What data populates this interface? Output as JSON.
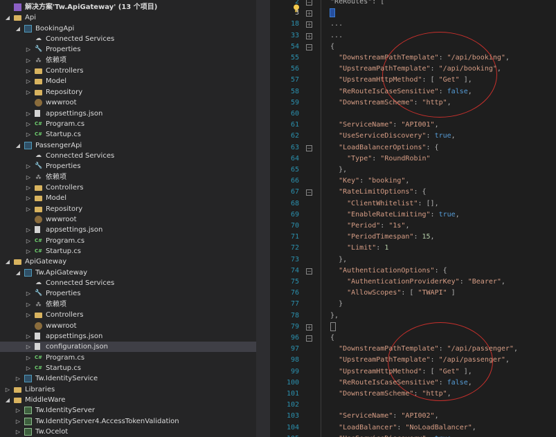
{
  "explorer": {
    "rows": [
      {
        "indent": 0,
        "arrow": "",
        "icon": "solution",
        "label": "解决方案'Tw.ApiGateway' (13 个项目)",
        "name": "solution-root"
      },
      {
        "indent": 0,
        "arrow": "open",
        "icon": "folder",
        "label": "Api",
        "name": "folder-api"
      },
      {
        "indent": 1,
        "arrow": "open",
        "icon": "project",
        "label": "BookingApi",
        "name": "project-bookingapi"
      },
      {
        "indent": 2,
        "arrow": "",
        "icon": "cloud",
        "label": "Connected Services",
        "name": "tree-item"
      },
      {
        "indent": 2,
        "arrow": "closed",
        "icon": "wrench",
        "label": "Properties",
        "name": "tree-item"
      },
      {
        "indent": 2,
        "arrow": "closed",
        "icon": "deps",
        "label": "依赖项",
        "name": "tree-item"
      },
      {
        "indent": 2,
        "arrow": "closed",
        "icon": "folder",
        "label": "Controllers",
        "name": "tree-item"
      },
      {
        "indent": 2,
        "arrow": "closed",
        "icon": "folder",
        "label": "Model",
        "name": "tree-item"
      },
      {
        "indent": 2,
        "arrow": "closed",
        "icon": "folder",
        "label": "Repository",
        "name": "tree-item"
      },
      {
        "indent": 2,
        "arrow": "",
        "icon": "web",
        "label": "wwwroot",
        "name": "tree-item"
      },
      {
        "indent": 2,
        "arrow": "closed",
        "icon": "json",
        "label": "appsettings.json",
        "name": "tree-item"
      },
      {
        "indent": 2,
        "arrow": "closed",
        "icon": "cs",
        "label": "Program.cs",
        "name": "tree-item"
      },
      {
        "indent": 2,
        "arrow": "closed",
        "icon": "cs",
        "label": "Startup.cs",
        "name": "tree-item"
      },
      {
        "indent": 1,
        "arrow": "open",
        "icon": "project",
        "label": "PassengerApi",
        "name": "project-passengerapi"
      },
      {
        "indent": 2,
        "arrow": "",
        "icon": "cloud",
        "label": "Connected Services",
        "name": "tree-item"
      },
      {
        "indent": 2,
        "arrow": "closed",
        "icon": "wrench",
        "label": "Properties",
        "name": "tree-item"
      },
      {
        "indent": 2,
        "arrow": "closed",
        "icon": "deps",
        "label": "依赖项",
        "name": "tree-item"
      },
      {
        "indent": 2,
        "arrow": "closed",
        "icon": "folder",
        "label": "Controllers",
        "name": "tree-item"
      },
      {
        "indent": 2,
        "arrow": "closed",
        "icon": "folder",
        "label": "Model",
        "name": "tree-item"
      },
      {
        "indent": 2,
        "arrow": "closed",
        "icon": "folder",
        "label": "Repository",
        "name": "tree-item"
      },
      {
        "indent": 2,
        "arrow": "",
        "icon": "web",
        "label": "wwwroot",
        "name": "tree-item"
      },
      {
        "indent": 2,
        "arrow": "closed",
        "icon": "json",
        "label": "appsettings.json",
        "name": "tree-item"
      },
      {
        "indent": 2,
        "arrow": "closed",
        "icon": "cs",
        "label": "Program.cs",
        "name": "tree-item"
      },
      {
        "indent": 2,
        "arrow": "closed",
        "icon": "cs",
        "label": "Startup.cs",
        "name": "tree-item"
      },
      {
        "indent": 0,
        "arrow": "open",
        "icon": "folder",
        "label": "ApiGateway",
        "name": "folder-apigateway"
      },
      {
        "indent": 1,
        "arrow": "open",
        "icon": "project",
        "label": "Tw.ApiGateway",
        "name": "project-tw-apigateway"
      },
      {
        "indent": 2,
        "arrow": "",
        "icon": "cloud",
        "label": "Connected Services",
        "name": "tree-item"
      },
      {
        "indent": 2,
        "arrow": "closed",
        "icon": "wrench",
        "label": "Properties",
        "name": "tree-item"
      },
      {
        "indent": 2,
        "arrow": "closed",
        "icon": "deps",
        "label": "依赖项",
        "name": "tree-item"
      },
      {
        "indent": 2,
        "arrow": "closed",
        "icon": "folder",
        "label": "Controllers",
        "name": "tree-item"
      },
      {
        "indent": 2,
        "arrow": "",
        "icon": "web",
        "label": "wwwroot",
        "name": "tree-item"
      },
      {
        "indent": 2,
        "arrow": "closed",
        "icon": "json",
        "label": "appsettings.json",
        "name": "tree-item"
      },
      {
        "indent": 2,
        "arrow": "closed",
        "icon": "json",
        "label": "configuration.json",
        "name": "tree-item-configuration-json",
        "selected": true
      },
      {
        "indent": 2,
        "arrow": "closed",
        "icon": "cs",
        "label": "Program.cs",
        "name": "tree-item"
      },
      {
        "indent": 2,
        "arrow": "closed",
        "icon": "cs",
        "label": "Startup.cs",
        "name": "tree-item"
      },
      {
        "indent": 1,
        "arrow": "closed",
        "icon": "project",
        "label": "Tw.IdentityService",
        "name": "project-tw-identityservice"
      },
      {
        "indent": 0,
        "arrow": "closed",
        "icon": "folder",
        "label": "Libraries",
        "name": "folder-libraries"
      },
      {
        "indent": 0,
        "arrow": "open",
        "icon": "folder",
        "label": "MiddleWare",
        "name": "folder-middleware"
      },
      {
        "indent": 1,
        "arrow": "closed",
        "icon": "cr",
        "label": "Tw.IdentityServer",
        "name": "project-tw-identityserver"
      },
      {
        "indent": 1,
        "arrow": "closed",
        "icon": "cr",
        "label": "Tw.IdentityServer4.AccessTokenValidation",
        "name": "project-tw-identityserver4"
      },
      {
        "indent": 1,
        "arrow": "closed",
        "icon": "cr",
        "label": "Tw.Ocelot",
        "name": "project-tw-ocelot"
      }
    ]
  },
  "editor": {
    "lines": [
      {
        "num": "2",
        "fold": "open",
        "code": [
          [
            "p",
            "  \"ReRoutes\": ["
          ]
        ]
      },
      {
        "num": "3",
        "fold": "closed",
        "current": true,
        "code": [
          [
            "p",
            "  "
          ],
          [
            "cur",
            " "
          ]
        ]
      },
      {
        "num": "18",
        "fold": "closed",
        "code": [
          [
            "p",
            "  ..."
          ]
        ]
      },
      {
        "num": "33",
        "fold": "closed",
        "code": [
          [
            "p",
            "  ..."
          ]
        ]
      },
      {
        "num": "54",
        "fold": "open",
        "code": [
          [
            "p",
            "  {"
          ]
        ]
      },
      {
        "num": "55",
        "fold": "",
        "code": [
          [
            "k",
            "    \"DownstreamPathTemplate\""
          ],
          [
            "p",
            ": "
          ],
          [
            "k",
            "\"/api/booking\""
          ],
          [
            "p",
            ","
          ]
        ]
      },
      {
        "num": "56",
        "fold": "",
        "code": [
          [
            "k",
            "    \"UpstreamPathTemplate\""
          ],
          [
            "p",
            ": "
          ],
          [
            "k",
            "\"/api/booking\""
          ],
          [
            "p",
            ","
          ]
        ]
      },
      {
        "num": "57",
        "fold": "",
        "code": [
          [
            "k",
            "    \"UpstreamHttpMethod\""
          ],
          [
            "p",
            ": [ "
          ],
          [
            "k",
            "\"Get\""
          ],
          [
            "p",
            " ],"
          ]
        ]
      },
      {
        "num": "58",
        "fold": "",
        "code": [
          [
            "k",
            "    \"ReRouteIsCaseSensitive\""
          ],
          [
            "p",
            ": "
          ],
          [
            "b",
            "false"
          ],
          [
            "p",
            ","
          ]
        ]
      },
      {
        "num": "59",
        "fold": "",
        "code": [
          [
            "k",
            "    \"DownstreamScheme\""
          ],
          [
            "p",
            ": "
          ],
          [
            "k",
            "\"http\""
          ],
          [
            "p",
            ","
          ]
        ]
      },
      {
        "num": "60",
        "fold": "",
        "code": [
          [
            "p",
            ""
          ]
        ]
      },
      {
        "num": "61",
        "fold": "",
        "code": [
          [
            "k",
            "    \"ServiceName\""
          ],
          [
            "p",
            ": "
          ],
          [
            "k",
            "\"API001\""
          ],
          [
            "p",
            ","
          ]
        ]
      },
      {
        "num": "62",
        "fold": "",
        "code": [
          [
            "k",
            "    \"UseServiceDiscovery\""
          ],
          [
            "p",
            ": "
          ],
          [
            "b",
            "true"
          ],
          [
            "p",
            ","
          ]
        ]
      },
      {
        "num": "63",
        "fold": "open",
        "code": [
          [
            "k",
            "    \"LoadBalancerOptions\""
          ],
          [
            "p",
            ": {"
          ]
        ]
      },
      {
        "num": "64",
        "fold": "",
        "code": [
          [
            "k",
            "      \"Type\""
          ],
          [
            "p",
            ": "
          ],
          [
            "k",
            "\"RoundRobin\""
          ]
        ]
      },
      {
        "num": "65",
        "fold": "",
        "code": [
          [
            "p",
            "    },"
          ]
        ]
      },
      {
        "num": "66",
        "fold": "",
        "code": [
          [
            "k",
            "    \"Key\""
          ],
          [
            "p",
            ": "
          ],
          [
            "k",
            "\"booking\""
          ],
          [
            "p",
            ","
          ]
        ]
      },
      {
        "num": "67",
        "fold": "open",
        "code": [
          [
            "k",
            "    \"RateLimitOptions\""
          ],
          [
            "p",
            ": {"
          ]
        ]
      },
      {
        "num": "68",
        "fold": "",
        "code": [
          [
            "k",
            "      \"ClientWhitelist\""
          ],
          [
            "p",
            ": [],"
          ]
        ]
      },
      {
        "num": "69",
        "fold": "",
        "code": [
          [
            "k",
            "      \"EnableRateLimiting\""
          ],
          [
            "p",
            ": "
          ],
          [
            "b",
            "true"
          ],
          [
            "p",
            ","
          ]
        ]
      },
      {
        "num": "70",
        "fold": "",
        "code": [
          [
            "k",
            "      \"Period\""
          ],
          [
            "p",
            ": "
          ],
          [
            "k",
            "\"1s\""
          ],
          [
            "p",
            ","
          ]
        ]
      },
      {
        "num": "71",
        "fold": "",
        "code": [
          [
            "k",
            "      \"PeriodTimespan\""
          ],
          [
            "p",
            ": "
          ],
          [
            "n",
            "15"
          ],
          [
            "p",
            ","
          ]
        ]
      },
      {
        "num": "72",
        "fold": "",
        "code": [
          [
            "k",
            "      \"Limit\""
          ],
          [
            "p",
            ": "
          ],
          [
            "n",
            "1"
          ]
        ]
      },
      {
        "num": "73",
        "fold": "",
        "code": [
          [
            "p",
            "    },"
          ]
        ]
      },
      {
        "num": "74",
        "fold": "open",
        "code": [
          [
            "k",
            "    \"AuthenticationOptions\""
          ],
          [
            "p",
            ": {"
          ]
        ]
      },
      {
        "num": "75",
        "fold": "",
        "code": [
          [
            "k",
            "      \"AuthenticationProviderKey\""
          ],
          [
            "p",
            ": "
          ],
          [
            "k",
            "\"Bearer\""
          ],
          [
            "p",
            ","
          ]
        ]
      },
      {
        "num": "76",
        "fold": "",
        "code": [
          [
            "k",
            "      \"AllowScopes\""
          ],
          [
            "p",
            ": [ "
          ],
          [
            "k",
            "\"TWAPI\""
          ],
          [
            "p",
            " ]"
          ]
        ]
      },
      {
        "num": "77",
        "fold": "",
        "code": [
          [
            "p",
            "    }"
          ]
        ]
      },
      {
        "num": "78",
        "fold": "",
        "code": [
          [
            "p",
            "  },"
          ]
        ]
      },
      {
        "num": "79",
        "fold": "closed",
        "code": [
          [
            "p",
            "  "
          ],
          [
            "box",
            " "
          ]
        ]
      },
      {
        "num": "96",
        "fold": "open",
        "code": [
          [
            "p",
            "  {"
          ]
        ]
      },
      {
        "num": "97",
        "fold": "",
        "code": [
          [
            "k",
            "    \"DownstreamPathTemplate\""
          ],
          [
            "p",
            ": "
          ],
          [
            "k",
            "\"/api/passenger\""
          ],
          [
            "p",
            ","
          ]
        ]
      },
      {
        "num": "98",
        "fold": "",
        "code": [
          [
            "k",
            "    \"UpstreamPathTemplate\""
          ],
          [
            "p",
            ": "
          ],
          [
            "k",
            "\"/api/passenger\""
          ],
          [
            "p",
            ","
          ]
        ]
      },
      {
        "num": "99",
        "fold": "",
        "code": [
          [
            "k",
            "    \"UpstreamHttpMethod\""
          ],
          [
            "p",
            ": [ "
          ],
          [
            "k",
            "\"Get\""
          ],
          [
            "p",
            " ],"
          ]
        ]
      },
      {
        "num": "100",
        "fold": "",
        "code": [
          [
            "k",
            "    \"ReRouteIsCaseSensitive\""
          ],
          [
            "p",
            ": "
          ],
          [
            "b",
            "false"
          ],
          [
            "p",
            ","
          ]
        ]
      },
      {
        "num": "101",
        "fold": "",
        "code": [
          [
            "k",
            "    \"DownstreamScheme\""
          ],
          [
            "p",
            ": "
          ],
          [
            "k",
            "\"http\""
          ],
          [
            "p",
            ","
          ]
        ]
      },
      {
        "num": "102",
        "fold": "",
        "code": [
          [
            "p",
            ""
          ]
        ]
      },
      {
        "num": "103",
        "fold": "",
        "code": [
          [
            "k",
            "    \"ServiceName\""
          ],
          [
            "p",
            ": "
          ],
          [
            "k",
            "\"API002\""
          ],
          [
            "p",
            ","
          ]
        ]
      },
      {
        "num": "104",
        "fold": "",
        "code": [
          [
            "k",
            "    \"LoadBalancer\""
          ],
          [
            "p",
            ": "
          ],
          [
            "k",
            "\"NoLoadBalancer\""
          ],
          [
            "p",
            ","
          ]
        ]
      },
      {
        "num": "105",
        "fold": "",
        "code": [
          [
            "k",
            "    \"UseServiceDiscovery\""
          ],
          [
            "p",
            ": "
          ],
          [
            "b",
            "true"
          ],
          [
            "p",
            ","
          ]
        ]
      }
    ]
  }
}
